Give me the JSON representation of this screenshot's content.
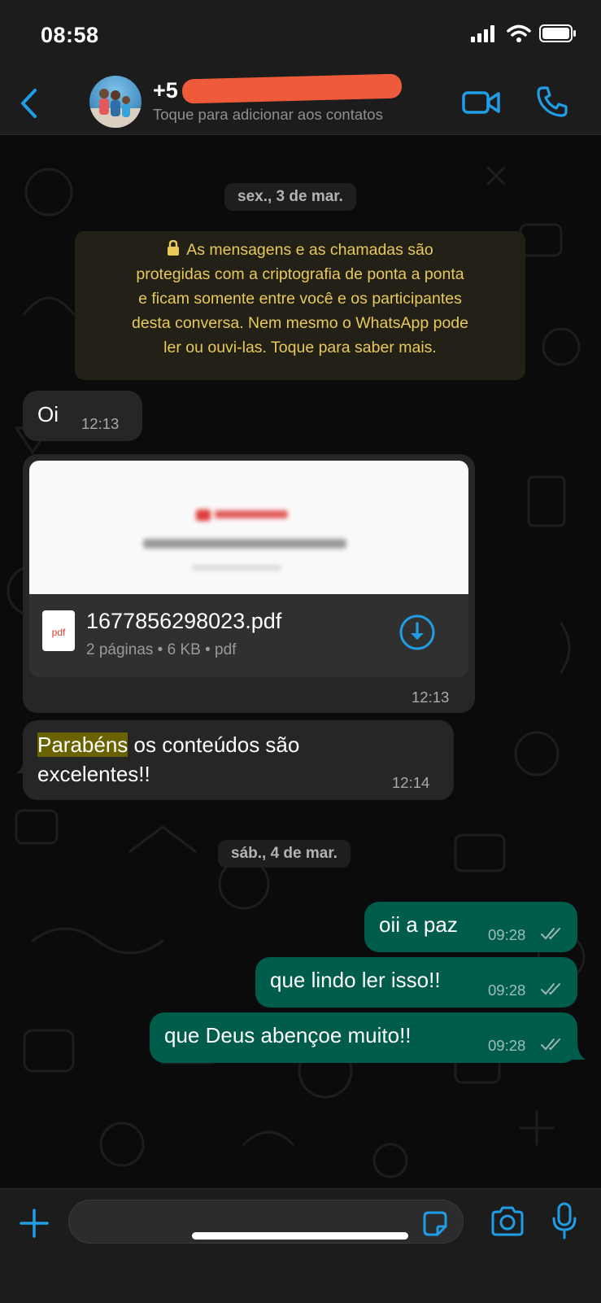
{
  "status_bar": {
    "time": "08:58"
  },
  "header": {
    "contact_name_visible": "+5",
    "subtitle": "Toque para adicionar aos contatos"
  },
  "chat": {
    "date_1": "sex., 3 de mar.",
    "encryption_notice": [
      "As mensagens e as chamadas são",
      "protegidas com a criptografia de ponta a ponta",
      "e ficam somente entre você e os participantes",
      "desta conversa. Nem mesmo o WhatsApp pode",
      "ler ou ouvi-las. Toque para saber mais."
    ],
    "msg_oi": {
      "text": "Oi",
      "time": "12:13"
    },
    "document": {
      "icon_label": "pdf",
      "file_name": "1677856298023.pdf",
      "meta": "2 páginas • 6 KB • pdf",
      "time": "12:13"
    },
    "msg_parabens": {
      "highlight": "Parabéns",
      "rest_line1": " os conteúdos são",
      "line2": "excelentes!!",
      "time": "12:14"
    },
    "date_2": "sáb., 4 de mar.",
    "outgoing": [
      {
        "text": "oii a paz",
        "time": "09:28"
      },
      {
        "text": "que lindo ler isso!!",
        "time": "09:28"
      },
      {
        "text": "que Deus abençoe muito!!",
        "time": "09:28"
      }
    ]
  },
  "colors": {
    "accent": "#1f9ee6",
    "incoming_bubble": "#262626",
    "outgoing_bubble": "#005c4b",
    "notice_text": "#e8c95a",
    "highlight": "#6a6100"
  }
}
